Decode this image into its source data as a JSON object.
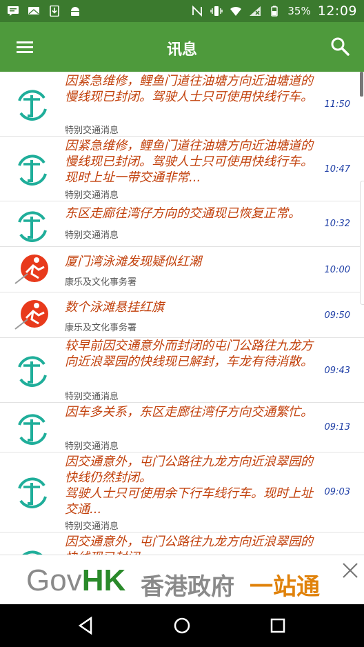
{
  "status_bar": {
    "battery_percent_label": "35%",
    "time": "12:09"
  },
  "app_bar": {
    "title": "讯息"
  },
  "items": [
    {
      "text": "因紧急维修，鲤鱼门道往油塘方向近油塘道的慢线现已封闭。驾驶人士只可使用快线行车。",
      "source": "特别交通消息",
      "time": "11:50",
      "logo": "transport-logo"
    },
    {
      "text": "因紧急维修，鲤鱼门道往油塘方向近油塘道的慢线现已封闭。驾驶人士只可使用快线行车。现时上址一带交通非常...",
      "source": "特别交通消息",
      "time": "10:47",
      "logo": "transport-logo"
    },
    {
      "text": "东区走廊往湾仔方向的交通现已恢复正常。",
      "source": "特别交通消息",
      "time": "10:32",
      "logo": "transport-logo"
    },
    {
      "text": "厦门湾泳滩发现疑似红潮",
      "source": "康乐及文化事务署",
      "time": "10:00",
      "logo": "lcsd-logo"
    },
    {
      "text": "数个泳滩悬挂红旗",
      "source": "康乐及文化事务署",
      "time": "09:50",
      "logo": "lcsd-logo"
    },
    {
      "text": "较早前因交通意外而封闭的屯门公路往九龙方向近浪翠园的快线现已解封，车龙有待消散。",
      "source": "特别交通消息",
      "time": "09:43",
      "logo": "transport-logo"
    },
    {
      "text": "因车多关系，东区走廊往湾仔方向交通繁忙。",
      "source": "特别交通消息",
      "time": "09:13",
      "logo": "transport-logo"
    },
    {
      "text": "因交通意外，屯门公路往九龙方向近浪翠园的快线仍然封闭。\n驾驶人士只可使用余下行车线行车。现时上址交通...",
      "source": "特别交通消息",
      "time": "09:03",
      "logo": "transport-logo"
    },
    {
      "text": "因交通意外，屯门公路往九龙方向近浪翠园的快线现已封闭...",
      "source": "",
      "time": "",
      "logo": "transport-logo"
    }
  ],
  "ad": {
    "brand_gov": "Gov",
    "brand_hk": "HK",
    "cn_part1": "香港政府",
    "cn_part2": "一站通"
  },
  "colors": {
    "status_bar": "#3b7a2e",
    "app_bar": "#4e9a3c",
    "item_text": "#c2410c",
    "item_time": "#1f3fa6"
  }
}
